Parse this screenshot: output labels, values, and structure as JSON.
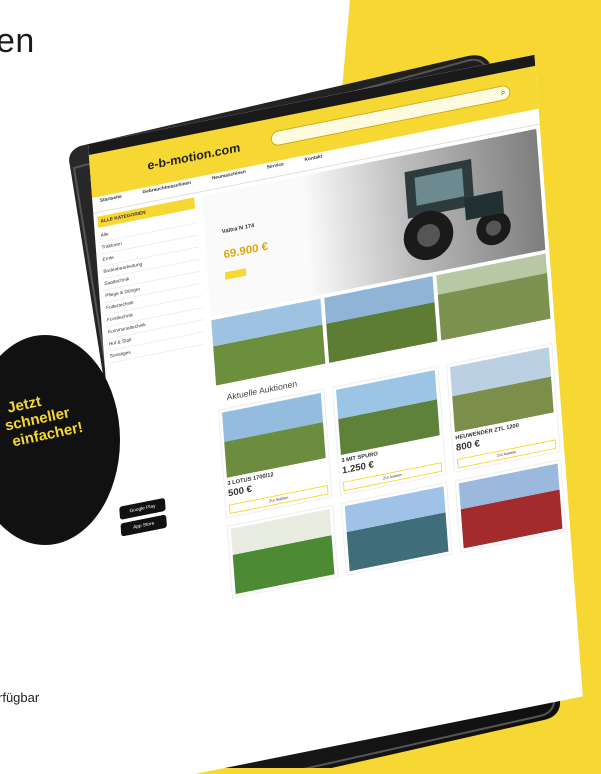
{
  "headline": "en",
  "footnote": "rfügbar",
  "badge": {
    "line1": "Jetzt",
    "line2": "schneller",
    "line3": "einfacher!"
  },
  "tablet_screen": {
    "logo": "e-b-motion.com",
    "nav": [
      "Startseite",
      "Gebrauchtmaschinen",
      "Neumaschinen",
      "Service",
      "Kontakt"
    ],
    "categories_title": "ALLE KATEGORIEN",
    "categories": [
      "Alle",
      "Traktoren",
      "Ernte",
      "Bodenbearbeitung",
      "Saattechnik",
      "Pflege & Dünger",
      "Futtertechnik",
      "Forsttechnik",
      "Kommunaltechnik",
      "Hof & Stall",
      "Sonstiges"
    ],
    "hero_title": "Valtra N 174",
    "hero_price": "69.900 €",
    "section_title": "Aktuelle Auktionen",
    "cards": [
      {
        "title": "3 LOTUS 1700/12",
        "price": "500 €",
        "button": "Zur Auktion"
      },
      {
        "title": "3 MIT SPURO",
        "price": "1.250 €",
        "button": "Zur Auktion"
      },
      {
        "title": "HEUWENDER ZTL 1200",
        "price": "800 €",
        "button": "Zur Auktion"
      }
    ],
    "store_google": "Google Play",
    "store_apple": "App Store"
  },
  "colors": {
    "accent": "#f7d731",
    "badge_bg": "#111111",
    "tablet_frame": "#1b1b1b"
  }
}
